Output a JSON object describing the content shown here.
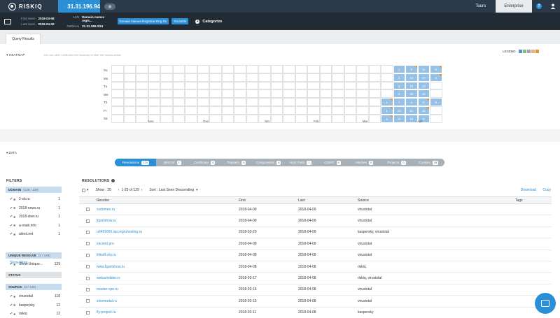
{
  "app": {
    "logo": "RISKIQ",
    "query": "31.31.196.94"
  },
  "nav": {
    "tours": "Tours",
    "enterprise": "Enterprise",
    "help": "?"
  },
  "info": {
    "first_seen_label": "First Seen",
    "first_seen": "2018-03-08",
    "last_seen_label": "Last Seen",
    "last_seen": "2018-04-09",
    "asn_label": "ASN",
    "asn": "Domain names regis...",
    "netblock_label": "Netblock",
    "netblock": "31.31.196.0/24",
    "tags": [
      "Domain-Names-Registrar-Reg.Ru",
      "Routable"
    ],
    "categorize": "Categorize"
  },
  "tabs": {
    "query_results": "Query Results"
  },
  "heatmap": {
    "label": "▾ HEATMAP",
    "hint": "You can click / shift-click the heatmap to filter the results below",
    "legend": "LEGEND",
    "legend_colors": [
      "#4f93cf",
      "#7fc078",
      "#a6a6a6",
      "#e0b48a",
      "#e8932f"
    ],
    "days": [
      "Su",
      "Mo",
      "Tu",
      "We",
      "Th",
      "Fr",
      "Sa"
    ],
    "months": [
      {
        "name": "Nov",
        "col": 3
      },
      {
        "name": "Dec",
        "col": 7.5
      },
      {
        "name": "Jan",
        "col": 12.5
      },
      {
        "name": "Feb",
        "col": 16.5
      },
      {
        "name": "Mar",
        "col": 20.5
      },
      {
        "name": "Apr",
        "col": 25
      }
    ],
    "grid_rows": [
      [
        "",
        "",
        "",
        "",
        "",
        "",
        "",
        "",
        "",
        "",
        "",
        "",
        "",
        "",
        "",
        "",
        "",
        "",
        "",
        "",
        "",
        "",
        "",
        "1",
        "5",
        "11",
        "6"
      ],
      [
        "",
        "",
        "",
        "",
        "",
        "",
        "",
        "",
        "",
        "",
        "",
        "",
        "",
        "",
        "",
        "",
        "",
        "",
        "",
        "",
        "",
        "",
        "",
        "4",
        "14",
        "17",
        "5"
      ],
      [
        "",
        "",
        "",
        "",
        "",
        "",
        "",
        "",
        "",
        "",
        "",
        "",
        "",
        "",
        "",
        "",
        "",
        "",
        "",
        "",
        "",
        "",
        "",
        "3",
        "10",
        "13",
        ""
      ],
      [
        "",
        "",
        "",
        "",
        "",
        "",
        "",
        "",
        "",
        "",
        "",
        "",
        "",
        "",
        "",
        "",
        "",
        "",
        "",
        "",
        "",
        "",
        "",
        "4",
        "20",
        "11",
        ""
      ],
      [
        "",
        "",
        "",
        "",
        "",
        "",
        "",
        "",
        "",
        "",
        "",
        "",
        "",
        "",
        "",
        "",
        "",
        "",
        "",
        "",
        "",
        "",
        "1",
        "7",
        "4",
        "11",
        "8"
      ],
      [
        "",
        "",
        "",
        "",
        "",
        "",
        "",
        "",
        "",
        "",
        "",
        "",
        "",
        "",
        "",
        "",
        "",
        "",
        "",
        "",
        "",
        "",
        "1",
        "13",
        "11",
        "12",
        ""
      ],
      [
        "",
        "",
        "",
        "",
        "",
        "",
        "",
        "",
        "",
        "",
        "",
        "",
        "",
        "",
        "",
        "",
        "",
        "",
        "",
        "",
        "",
        "",
        "5",
        "11",
        "10",
        "8",
        ""
      ]
    ],
    "tri_cells": [
      [
        0,
        26
      ],
      [
        1,
        26
      ],
      [
        4,
        22
      ],
      [
        5,
        22
      ],
      [
        5,
        25
      ],
      [
        6,
        22
      ],
      [
        4,
        25
      ],
      [
        0,
        24
      ]
    ]
  },
  "data_label": "▾ DATA",
  "data_tabs": [
    {
      "label": "Resolutions",
      "count": "129",
      "active": true
    },
    {
      "label": "WHOIS",
      "count": "1"
    },
    {
      "label": "Certificate",
      "count": "4"
    },
    {
      "label": "Trackers",
      "count": "0"
    },
    {
      "label": "Components",
      "count": "0"
    },
    {
      "label": "Host Pairs",
      "count": "1"
    },
    {
      "label": "OSINT",
      "count": "6"
    },
    {
      "label": "Hashes",
      "count": "0"
    },
    {
      "label": "Projects",
      "count": "0"
    },
    {
      "label": "Cookies",
      "count": "28"
    }
  ],
  "filters": {
    "title": "FILTERS",
    "domain_title": "DOMAIN",
    "domain_count": "(129 / 129)",
    "domain_items": [
      {
        "name": "2-sb.ru",
        "count": "1"
      },
      {
        "name": "2018-news.ru",
        "count": "1"
      },
      {
        "name": "2018-sber.ru",
        "count": "1"
      },
      {
        "name": "a-snab.info",
        "count": "1"
      },
      {
        "name": "aitool.net",
        "count": "1"
      }
    ],
    "show_more": "Show More...",
    "unique_title": "UNIQUE RESOLVE",
    "unique_count": "(1 / 129)",
    "unique_items": [
      {
        "name": "Show Unique...",
        "count": "129"
      }
    ],
    "status_title": "STATUS",
    "source_title": "SOURCE",
    "source_count": "(4 / 149)",
    "source_items": [
      {
        "name": "virustotal",
        "count": "118"
      },
      {
        "name": "kaspersky",
        "count": "12"
      },
      {
        "name": "riskiq",
        "count": "12"
      }
    ]
  },
  "resolutions": {
    "title": "RESOLUTIONS",
    "show": "Show : 25",
    "range": "1-25 of 129",
    "sort": "Sort : Last Seen Descending",
    "download": "Download",
    "copy": "Copy",
    "columns": [
      "Resolve",
      "First",
      "Last",
      "Source",
      "Tags"
    ],
    "rows": [
      [
        "svdomen.ru",
        "2018-04-09",
        "2018-04-09",
        "virustotal",
        ""
      ],
      [
        "ligartshow.ru",
        "2018-04-09",
        "2018-04-09",
        "virustotal",
        ""
      ],
      [
        "u0481665.isp.regruhosting.ru",
        "2018-03-20",
        "2018-04-09",
        "kaspersky, virustotal",
        ""
      ],
      [
        "escentr.pro",
        "2018-04-09",
        "2018-04-09",
        "virustotal",
        ""
      ],
      [
        "klinoff-city.ru",
        "2018-04-09",
        "2018-04-09",
        "virustotal",
        ""
      ],
      [
        "www.ligartshow.ru",
        "2018-04-08",
        "2018-04-08",
        "riskiq",
        ""
      ],
      [
        "webavtolider.ru",
        "2018-03-17",
        "2018-04-08",
        "riskiq, virustotal",
        ""
      ],
      [
        "master-vpn.ru",
        "2018-03-16",
        "2018-04-08",
        "virustotal",
        ""
      ],
      [
        "xinomodul.ru",
        "2018-03-15",
        "2018-04-08",
        "virustotal",
        ""
      ],
      [
        "fly-project.ru",
        "2018-03-11",
        "2018-04-08",
        "kaspersky",
        ""
      ]
    ]
  }
}
